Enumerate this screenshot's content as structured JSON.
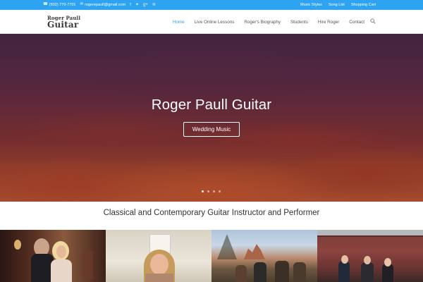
{
  "topbar": {
    "phone": "(602) 770-7701",
    "email": "rogerepaull@gmail.com",
    "social_icons": [
      "facebook-icon",
      "twitter-icon",
      "google-plus-icon",
      "rss-icon"
    ],
    "links": [
      "Music Styles",
      "Song List",
      "Shopping Cart"
    ],
    "bg_color": "#2ea3f2"
  },
  "header": {
    "logo_line1": "Roger Paull",
    "logo_line2": "Guitar",
    "nav": [
      "Home",
      "Live Online Lessons",
      "Roger's Biography",
      "Students",
      "Hire Roger",
      "Contact"
    ],
    "active_nav": "Home",
    "accent_color": "#2ea3f2"
  },
  "hero": {
    "title": "Roger Paull Guitar",
    "button_label": "Wedding Music",
    "slide_count": 4,
    "active_slide": 1
  },
  "tagline": "Classical and Contemporary Guitar Instructor and Performer",
  "photos": [
    "photo-guitarist-with-woman",
    "photo-smiling-student",
    "photo-group-red-rocks",
    "photo-group-red-barn"
  ]
}
